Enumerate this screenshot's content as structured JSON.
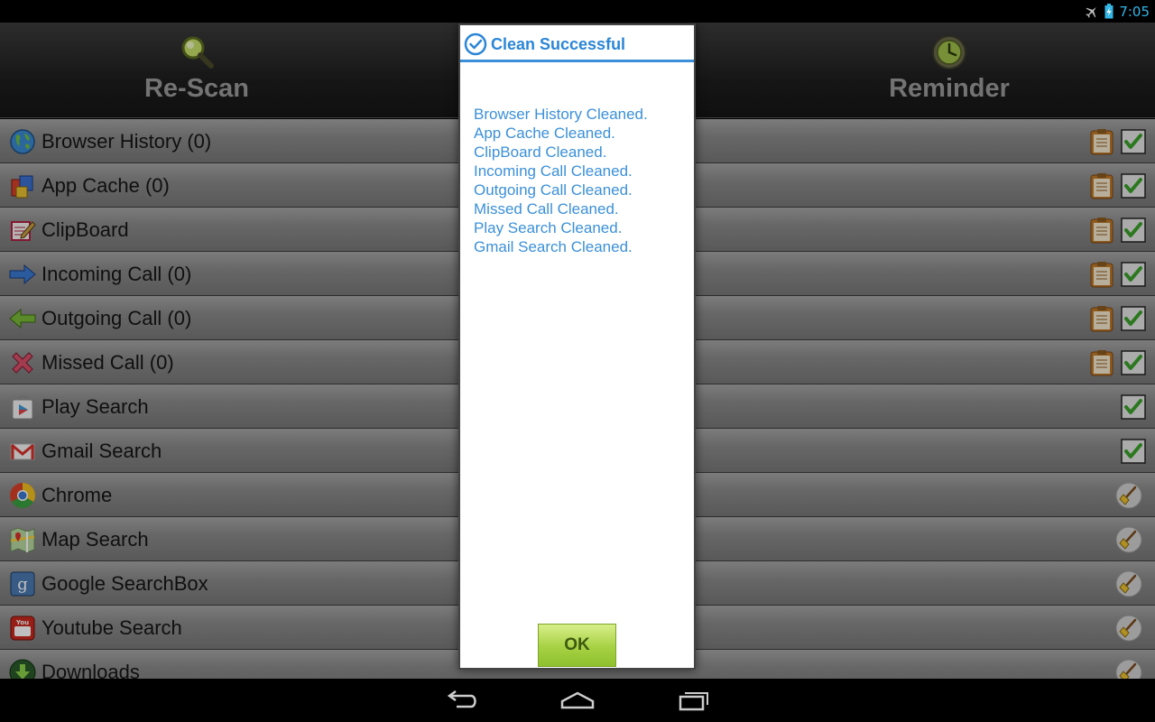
{
  "status_bar": {
    "time": "7:05",
    "icons": [
      "airplane-mode-icon",
      "battery-charging-icon"
    ]
  },
  "toolbar": {
    "rescan_label": "Re-Scan",
    "reminder_label": "Reminder"
  },
  "list": [
    {
      "label": "Browser History (0)",
      "icon": "globe-icon",
      "action": "clipboard+check"
    },
    {
      "label": "App Cache (0)",
      "icon": "app-cache-icon",
      "action": "clipboard+check"
    },
    {
      "label": "ClipBoard",
      "icon": "clipboard-edit-icon",
      "action": "clipboard+check"
    },
    {
      "label": "Incoming Call (0)",
      "icon": "incoming-arrow-icon",
      "action": "clipboard+check"
    },
    {
      "label": "Outgoing Call (0)",
      "icon": "outgoing-arrow-icon",
      "action": "clipboard+check"
    },
    {
      "label": "Missed Call (0)",
      "icon": "missed-x-icon",
      "action": "clipboard+check"
    },
    {
      "label": "Play Search",
      "icon": "play-store-icon",
      "action": "check"
    },
    {
      "label": "Gmail Search",
      "icon": "gmail-icon",
      "action": "check"
    },
    {
      "label": "Chrome",
      "icon": "chrome-icon",
      "action": "broom"
    },
    {
      "label": "Map Search",
      "icon": "maps-icon",
      "action": "broom"
    },
    {
      "label": "Google SearchBox",
      "icon": "google-search-icon",
      "action": "broom"
    },
    {
      "label": "Youtube Search",
      "icon": "youtube-icon",
      "action": "broom"
    },
    {
      "label": "Downloads",
      "icon": "download-icon",
      "action": "broom"
    }
  ],
  "dialog": {
    "title": "Clean Successful",
    "messages": [
      "Browser History Cleaned.",
      "App Cache Cleaned.",
      "ClipBoard Cleaned.",
      "Incoming Call Cleaned.",
      "Outgoing Call Cleaned.",
      "Missed Call Cleaned.",
      "Play Search Cleaned.",
      "Gmail Search Cleaned."
    ],
    "ok_label": "OK"
  },
  "colors": {
    "accent": "#2b86d6",
    "message": "#3b90d8",
    "ok_button": "#a6d143",
    "clock": "#33b5e5"
  }
}
